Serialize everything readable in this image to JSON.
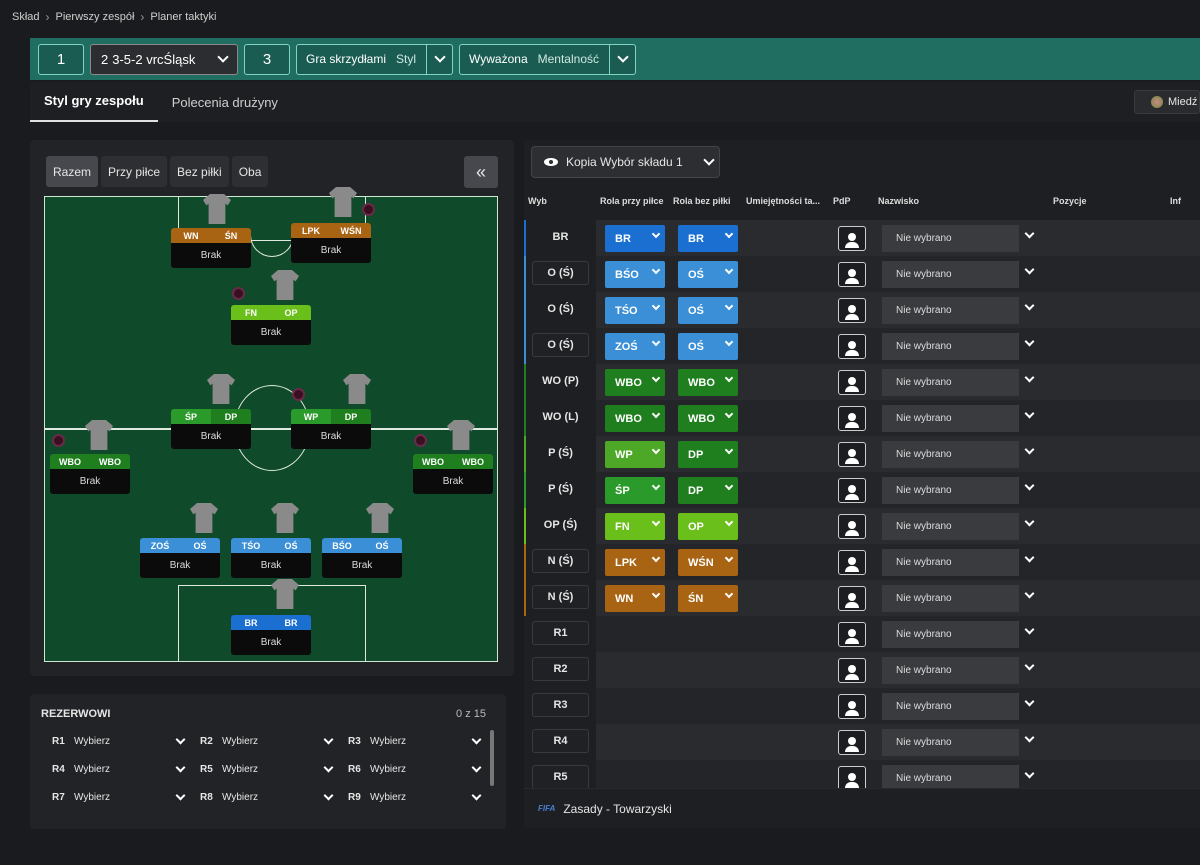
{
  "breadcrumb": [
    "Skład",
    "Pierwszy zespół",
    "Planer taktyki"
  ],
  "topbar": {
    "num1": "1",
    "formation": "3-5-2 vrcŚląsk",
    "formation_num": "2",
    "num3": "3",
    "style_a": "Gra skrzydłami",
    "style_a_sub": "Styl",
    "style_b": "Wyważona",
    "style_b_sub": "Mentalność"
  },
  "tabs": [
    "Styl gry zespołu",
    "Polecenia drużyny"
  ],
  "medal_label": "Miedź",
  "phase": [
    "Razem",
    "Przy piłce",
    "Bez piłki",
    "Oba"
  ],
  "pitch_cards": [
    {
      "a": "WN",
      "b": "ŚN",
      "ca": "#a86413",
      "cb": "#a86413",
      "name": "Brak"
    },
    {
      "a": "LPK",
      "b": "WŚN",
      "ca": "#a86413",
      "cb": "#a86413",
      "name": "Brak"
    },
    {
      "a": "FN",
      "b": "OP",
      "ca": "#6abf1a",
      "cb": "#6abf1a",
      "name": "Brak"
    },
    {
      "a": "ŚP",
      "b": "DP",
      "ca": "#2a9a2a",
      "cb": "#1f7f1f",
      "name": "Brak"
    },
    {
      "a": "WP",
      "b": "DP",
      "ca": "#2a9a2a",
      "cb": "#1f7f1f",
      "name": "Brak"
    },
    {
      "a": "WBO",
      "b": "WBO",
      "ca": "#1f7f1f",
      "cb": "#1f7f1f",
      "name": "Brak"
    },
    {
      "a": "WBO",
      "b": "WBO",
      "ca": "#1f7f1f",
      "cb": "#1f7f1f",
      "name": "Brak"
    },
    {
      "a": "ZOŚ",
      "b": "OŚ",
      "ca": "#3a8fd6",
      "cb": "#3a8fd6",
      "name": "Brak"
    },
    {
      "a": "TŚO",
      "b": "OŚ",
      "ca": "#3a8fd6",
      "cb": "#3a8fd6",
      "name": "Brak"
    },
    {
      "a": "BŚO",
      "b": "OŚ",
      "ca": "#3a8fd6",
      "cb": "#3a8fd6",
      "name": "Brak"
    },
    {
      "a": "BR",
      "b": "BR",
      "ca": "#1a6fd0",
      "cb": "#1a6fd0",
      "name": "Brak"
    }
  ],
  "bench": {
    "title": "REZERWOWI",
    "count": "0 z 15",
    "slots": [
      {
        "id": "R1",
        "label": "Wybierz"
      },
      {
        "id": "R2",
        "label": "Wybierz"
      },
      {
        "id": "R3",
        "label": "Wybierz"
      },
      {
        "id": "R4",
        "label": "Wybierz"
      },
      {
        "id": "R5",
        "label": "Wybierz"
      },
      {
        "id": "R6",
        "label": "Wybierz"
      },
      {
        "id": "R7",
        "label": "Wybierz"
      },
      {
        "id": "R8",
        "label": "Wybierz"
      },
      {
        "id": "R9",
        "label": "Wybierz"
      }
    ]
  },
  "view_select": "Kopia Wybór składu 1",
  "table_headers": [
    "Wyb",
    "Rola przy piłce",
    "Rola bez piłki",
    "Umiejętności ta...",
    "PdP",
    "Nazwisko",
    "Pozycje",
    "Inf"
  ],
  "rows": [
    {
      "pos": "BR",
      "r1": "BR",
      "r2": "BR",
      "c1": "#1a6fd0",
      "c2": "#1a6fd0",
      "accent": "#1a6fd0",
      "player": "Nie wybrano",
      "plain": true
    },
    {
      "pos": "O (Ś)",
      "r1": "BŚO",
      "r2": "OŚ",
      "c1": "#3a8fd6",
      "c2": "#3a8fd6",
      "accent": "#3a8fd6",
      "player": "Nie wybrano"
    },
    {
      "pos": "O (Ś)",
      "r1": "TŚO",
      "r2": "OŚ",
      "c1": "#3a8fd6",
      "c2": "#3a8fd6",
      "accent": "#3a8fd6",
      "player": "Nie wybrano",
      "plain": true
    },
    {
      "pos": "O (Ś)",
      "r1": "ZOŚ",
      "r2": "OŚ",
      "c1": "#3a8fd6",
      "c2": "#3a8fd6",
      "accent": "#3a8fd6",
      "player": "Nie wybrano"
    },
    {
      "pos": "WO (P)",
      "r1": "WBO",
      "r2": "WBO",
      "c1": "#1f7f1f",
      "c2": "#1f7f1f",
      "accent": "#1f7f1f",
      "player": "Nie wybrano",
      "plain": true
    },
    {
      "pos": "WO (L)",
      "r1": "WBO",
      "r2": "WBO",
      "c1": "#1f7f1f",
      "c2": "#1f7f1f",
      "accent": "#1f7f1f",
      "player": "Nie wybrano",
      "plain": true
    },
    {
      "pos": "P (Ś)",
      "r1": "WP",
      "r2": "DP",
      "c1": "#4ca826",
      "c2": "#1f7f1f",
      "accent": "#4ca826",
      "player": "Nie wybrano",
      "plain": true
    },
    {
      "pos": "P (Ś)",
      "r1": "ŚP",
      "r2": "DP",
      "c1": "#2a9a2a",
      "c2": "#1f7f1f",
      "accent": "#2a9a2a",
      "player": "Nie wybrano",
      "plain": true
    },
    {
      "pos": "OP (Ś)",
      "r1": "FN",
      "r2": "OP",
      "c1": "#6abf1a",
      "c2": "#6abf1a",
      "accent": "#6abf1a",
      "player": "Nie wybrano",
      "plain": true
    },
    {
      "pos": "N (Ś)",
      "r1": "LPK",
      "r2": "WŚN",
      "c1": "#a86413",
      "c2": "#a86413",
      "accent": "#a86413",
      "player": "Nie wybrano"
    },
    {
      "pos": "N (Ś)",
      "r1": "WN",
      "r2": "ŚN",
      "c1": "#a86413",
      "c2": "#a86413",
      "accent": "#a86413",
      "player": "Nie wybrano"
    },
    {
      "pos": "R1",
      "player": "Nie wybrano"
    },
    {
      "pos": "R2",
      "player": "Nie wybrano"
    },
    {
      "pos": "R3",
      "player": "Nie wybrano"
    },
    {
      "pos": "R4",
      "player": "Nie wybrano"
    },
    {
      "pos": "R5",
      "player": "Nie wybrano"
    }
  ],
  "footer": {
    "logo": "FIFA",
    "text": "Zasady - Towarzyski"
  }
}
